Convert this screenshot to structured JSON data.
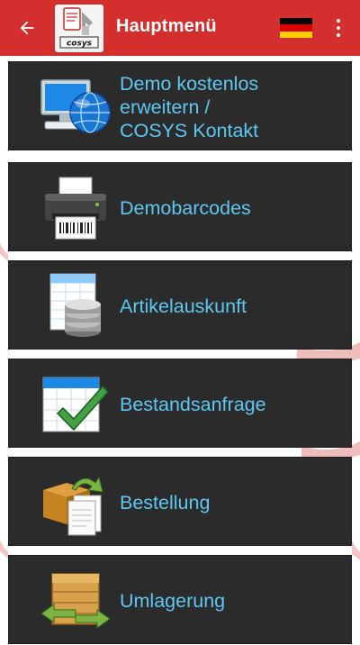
{
  "app_bar": {
    "title": "Hauptmenü",
    "colors": {
      "bar": "#d32f2f",
      "title": "#ffffff"
    }
  },
  "menu": {
    "items": [
      {
        "label": "Demo kostenlos\nerweitern /\nCOSYS Kontakt",
        "icon": "monitor-globe-icon"
      },
      {
        "label": "Demobarcodes",
        "icon": "printer-icon"
      },
      {
        "label": "Artikelauskunft",
        "icon": "database-table-icon"
      },
      {
        "label": "Bestandsanfrage",
        "icon": "calendar-check-icon"
      },
      {
        "label": "Bestellung",
        "icon": "box-documents-icon"
      },
      {
        "label": "Umlagerung",
        "icon": "crate-arrows-icon"
      }
    ],
    "colors": {
      "item_bg": "#2b2b2b",
      "label": "#5ec8f3"
    }
  }
}
